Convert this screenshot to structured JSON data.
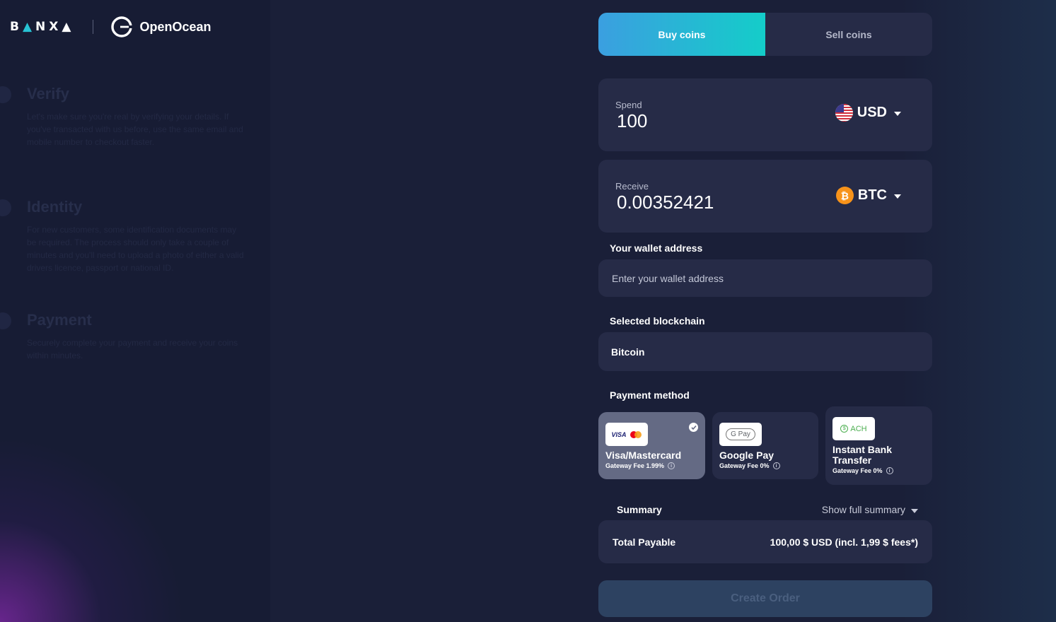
{
  "brand": {
    "banxa": "BANXA",
    "partner": "OpenOcean"
  },
  "steps": [
    {
      "title": "Verify",
      "text": "Let's make sure you're real by verifying your details. If you've transacted with us before, use the same email and mobile number to checkout faster."
    },
    {
      "title": "Identity",
      "text": "For new customers, some identification documents may be required. The process should only take a couple of minutes and you'll need to upload a photo of either a valid drivers licence, passport or national ID."
    },
    {
      "title": "Payment",
      "text": "Securely complete your payment and receive your coins within minutes."
    }
  ],
  "tabs": {
    "buy": "Buy coins",
    "sell": "Sell coins"
  },
  "spend": {
    "label": "Spend",
    "value": "100",
    "currency": "USD",
    "icon": "us-flag-icon"
  },
  "receive": {
    "label": "Receive",
    "value": "0.00352421",
    "currency": "BTC",
    "icon": "bitcoin-icon"
  },
  "wallet": {
    "label": "Your wallet address",
    "placeholder": "Enter your wallet address"
  },
  "blockchain": {
    "label": "Selected blockchain",
    "value": "Bitcoin"
  },
  "payment": {
    "label": "Payment method",
    "methods": [
      {
        "name": "Visa/Mastercard",
        "fee": "Gateway Fee 1.99%",
        "logo": "VISA",
        "selected": true
      },
      {
        "name": "Google Pay",
        "fee": "Gateway Fee 0%",
        "logo": "G Pay",
        "selected": false
      },
      {
        "name": "Instant Bank Transfer",
        "fee": "Gateway Fee 0%",
        "logo": "ACH",
        "selected": false
      }
    ]
  },
  "summary": {
    "title": "Summary",
    "toggle": "Show full summary",
    "total_label": "Total Payable",
    "total_value": "100,00 $ USD (incl. 1,99 $ fees*)"
  },
  "create_order": "Create Order",
  "colors": {
    "accent_start": "#3b9fe0",
    "accent_end": "#14cdc9",
    "panel": "#262b47",
    "background": "#1a1f38",
    "bitcoin": "#f7931a"
  }
}
